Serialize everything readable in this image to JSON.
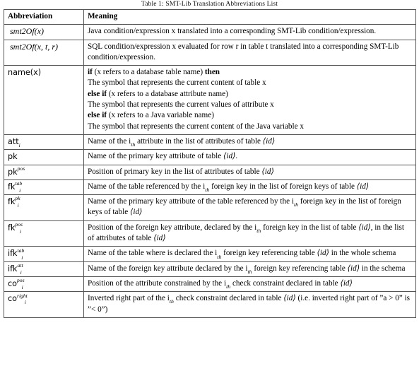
{
  "caption": "Table 1: SMT-Lib Translation Abbreviations List",
  "table": {
    "headers": {
      "col1": "Abbreviation",
      "col2": "Meaning"
    },
    "rows": [
      {
        "abbrev": "smt2Of(x)",
        "meaning": "Java condition/expression x translated into a corresponding SMT-Lib condition/expression."
      },
      {
        "abbrev": "smt2Of(x, t, r)",
        "meaning": "SQL condition/expression x evaluated for row r in table t translated into a corresponding SMT-Lib condition/expression."
      },
      {
        "abbrev": "name(x)",
        "meaning_lines": [
          "if (x refers to a database table name) then",
          "The symbol that represents the current content of table x",
          "else if (x refers to a database attribute name)",
          "The symbol that represents the current values of attribute x",
          "else if (x refers to a Java variable name)",
          "The symbol that represents the current content of the Java variable x"
        ],
        "keywords": [
          "if",
          "then",
          "else if",
          "else if"
        ]
      },
      {
        "abbrev_base": "att",
        "abbrev_sub": "i",
        "abbrev_sup": "",
        "meaning": "Name of the i_th attribute in the list of attributes of table ⟨id⟩"
      },
      {
        "abbrev_base": "pk",
        "abbrev_sub": "",
        "abbrev_sup": "",
        "meaning": "Name of the primary key attribute of table ⟨id⟩."
      },
      {
        "abbrev_base": "pk",
        "abbrev_sub": "",
        "abbrev_sup": "pos",
        "meaning": "Position of primary key in the list of attributes of table ⟨id⟩"
      },
      {
        "abbrev_base": "fk",
        "abbrev_sub": "i",
        "abbrev_sup": "tab",
        "meaning": "Name of the table referenced by the i_th foreign key in the list of foreign keys of table ⟨id⟩"
      },
      {
        "abbrev_base": "fk",
        "abbrev_sub": "i",
        "abbrev_sup": "pk",
        "meaning": "Name of the primary key attribute of the table referenced by the i_th foreign key in the list of foreign keys of table ⟨id⟩"
      },
      {
        "abbrev_base": "fk",
        "abbrev_sub": "i",
        "abbrev_sup": "pos",
        "meaning": "Position of the foreign key attribute, declared by the i_th foreign key in the list of table ⟨id⟩, in the list of attributes of table ⟨id⟩"
      },
      {
        "abbrev_base": "ifk",
        "abbrev_sub": "i",
        "abbrev_sup": "tab",
        "meaning": "Name of the table where is declared the i_th foreign key referencing table ⟨id⟩ in the whole schema"
      },
      {
        "abbrev_base": "ifk",
        "abbrev_sub": "i",
        "abbrev_sup": "att",
        "meaning": "Name of the foreign key attribute declared by the i_th foreign key referencing table ⟨id⟩ in the schema"
      },
      {
        "abbrev_base": "co",
        "abbrev_sub": "i",
        "abbrev_sup": "pos",
        "meaning": "Position of the attribute constrained by the i_th check constraint declared in table ⟨id⟩"
      },
      {
        "abbrev_base": "co",
        "abbrev_sub": "i",
        "abbrev_sup": "right",
        "meaning": "Inverted right part of the i_th check constraint declared in table ⟨id⟩ (i.e. inverted right part of ”a > 0” is ”< 0”)"
      }
    ]
  }
}
